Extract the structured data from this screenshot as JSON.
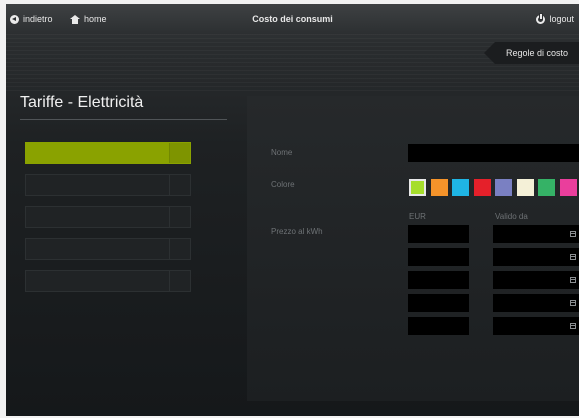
{
  "topbar": {
    "back_label": "indietro",
    "home_label": "home",
    "title": "Costo dei consumi",
    "logout_label": "logout"
  },
  "cost_rules_label": "Regole di costo",
  "section_title": "Tariffe - Elettricità",
  "tariffs": [
    {
      "active": true
    },
    {
      "active": false
    },
    {
      "active": false
    },
    {
      "active": false
    },
    {
      "active": false
    }
  ],
  "form": {
    "name_label": "Nome",
    "name_value": "",
    "color_label": "Colore",
    "price_label": "Prezzo al kWh",
    "currency_header": "EUR",
    "valid_from_header": "Valido da"
  },
  "colors": [
    "#a6de2c",
    "#f5932a",
    "#1fb5e4",
    "#e5202a",
    "#7a80c2",
    "#f4f0d7",
    "#35b266",
    "#ea3e9c"
  ],
  "selected_color_index": 0,
  "price_rows": [
    {
      "eur": "",
      "valid_from": ""
    },
    {
      "eur": "",
      "valid_from": ""
    },
    {
      "eur": "",
      "valid_from": ""
    },
    {
      "eur": "",
      "valid_from": ""
    },
    {
      "eur": "",
      "valid_from": ""
    }
  ]
}
